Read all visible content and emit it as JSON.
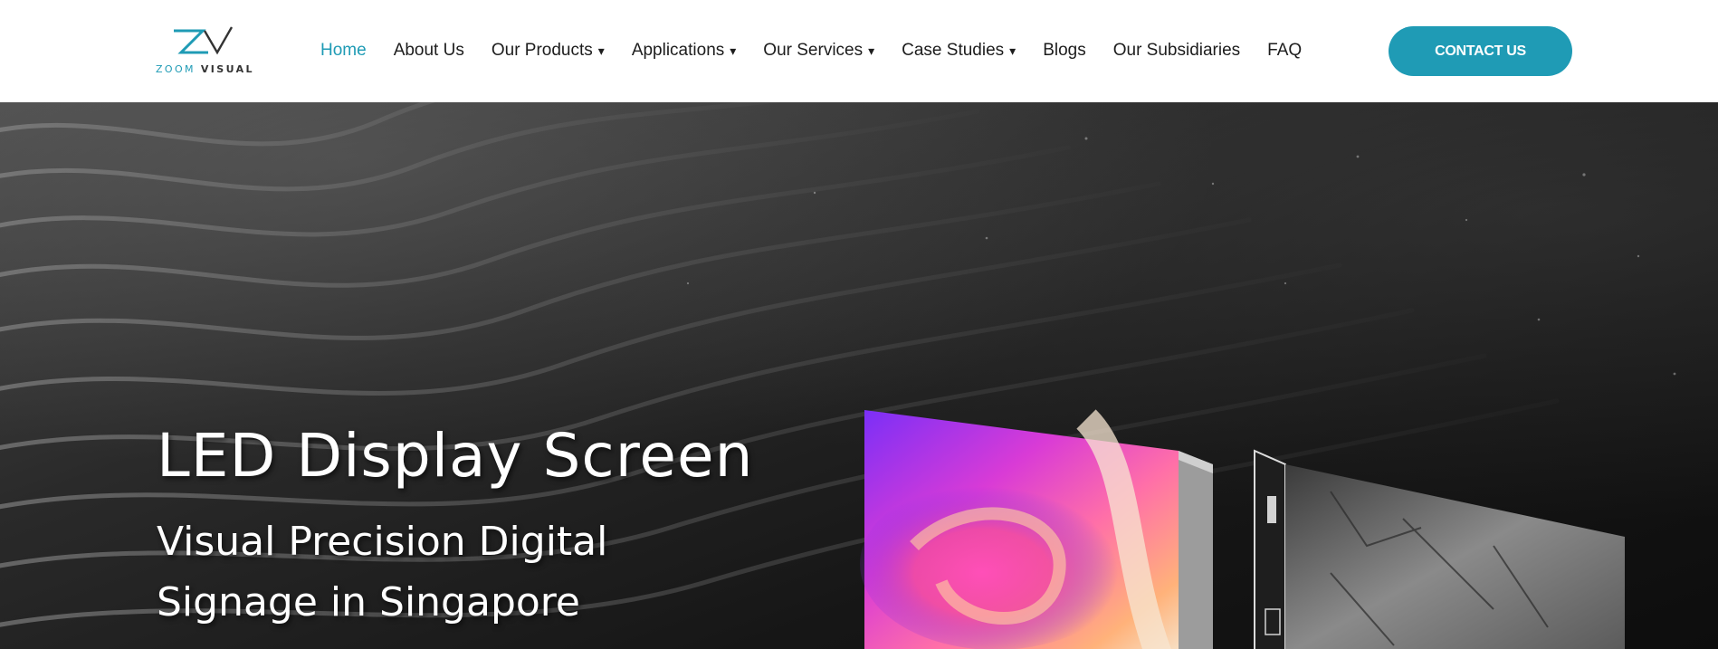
{
  "brand": {
    "logo_mark": "ZV",
    "logo_word_1": "ZOOM",
    "logo_word_2": "VISUAL",
    "accent_color": "#1f9bb5"
  },
  "nav": {
    "items": [
      {
        "label": "Home",
        "active": true,
        "dropdown": false
      },
      {
        "label": "About Us",
        "active": false,
        "dropdown": false
      },
      {
        "label": "Our Products",
        "active": false,
        "dropdown": true
      },
      {
        "label": "Applications",
        "active": false,
        "dropdown": true
      },
      {
        "label": "Our Services",
        "active": false,
        "dropdown": true
      },
      {
        "label": "Case Studies",
        "active": false,
        "dropdown": true
      },
      {
        "label": "Blogs",
        "active": false,
        "dropdown": false
      },
      {
        "label": "Our Subsidiaries",
        "active": false,
        "dropdown": false
      },
      {
        "label": "FAQ",
        "active": false,
        "dropdown": false
      }
    ],
    "caret": "▾"
  },
  "contact_button": {
    "label": "CONTACT US"
  },
  "hero": {
    "title": "LED Display Screen",
    "subtitle_line_1": "Visual Precision Digital",
    "subtitle_line_2": "Signage in Singapore",
    "background": "black-sand-dunes",
    "product_image": "led-display-cabinets"
  }
}
